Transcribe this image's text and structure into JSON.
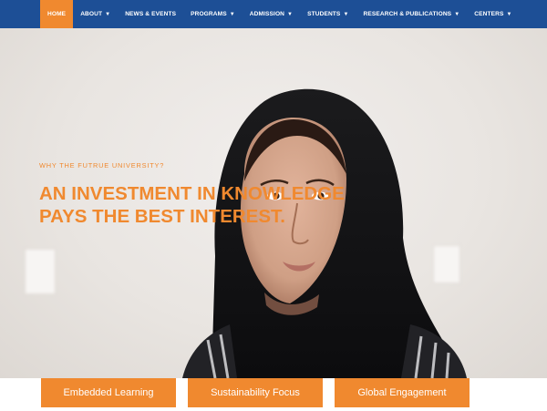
{
  "nav": {
    "items": [
      {
        "label": "HOME",
        "caret": ""
      },
      {
        "label": "ABOUT",
        "caret": "▼"
      },
      {
        "label": "NEWS & EVENTS",
        "caret": ""
      },
      {
        "label": "PROGRAMS",
        "caret": "▼"
      },
      {
        "label": "ADMISSION",
        "caret": "▼"
      },
      {
        "label": "STUDENTS",
        "caret": "▼"
      },
      {
        "label": "RESEARCH & PUBLICATIONS",
        "caret": "▼"
      },
      {
        "label": "CENTERS",
        "caret": "▼"
      }
    ],
    "active_index": 0
  },
  "hero": {
    "kicker": "WHY THE FUTRUE UNIVERSITY?",
    "headline_line1": "AN INVESTMENT IN KNOWLEDGE",
    "headline_line2": "PAYS THE BEST INTEREST.",
    "slides_count": 2,
    "active_slide": 2
  },
  "features": [
    {
      "label": "Embedded Learning"
    },
    {
      "label": "Sustainability Focus"
    },
    {
      "label": "Global Engagement"
    }
  ],
  "colors": {
    "nav_bg": "#1d4f96",
    "accent": "#f0892f"
  }
}
